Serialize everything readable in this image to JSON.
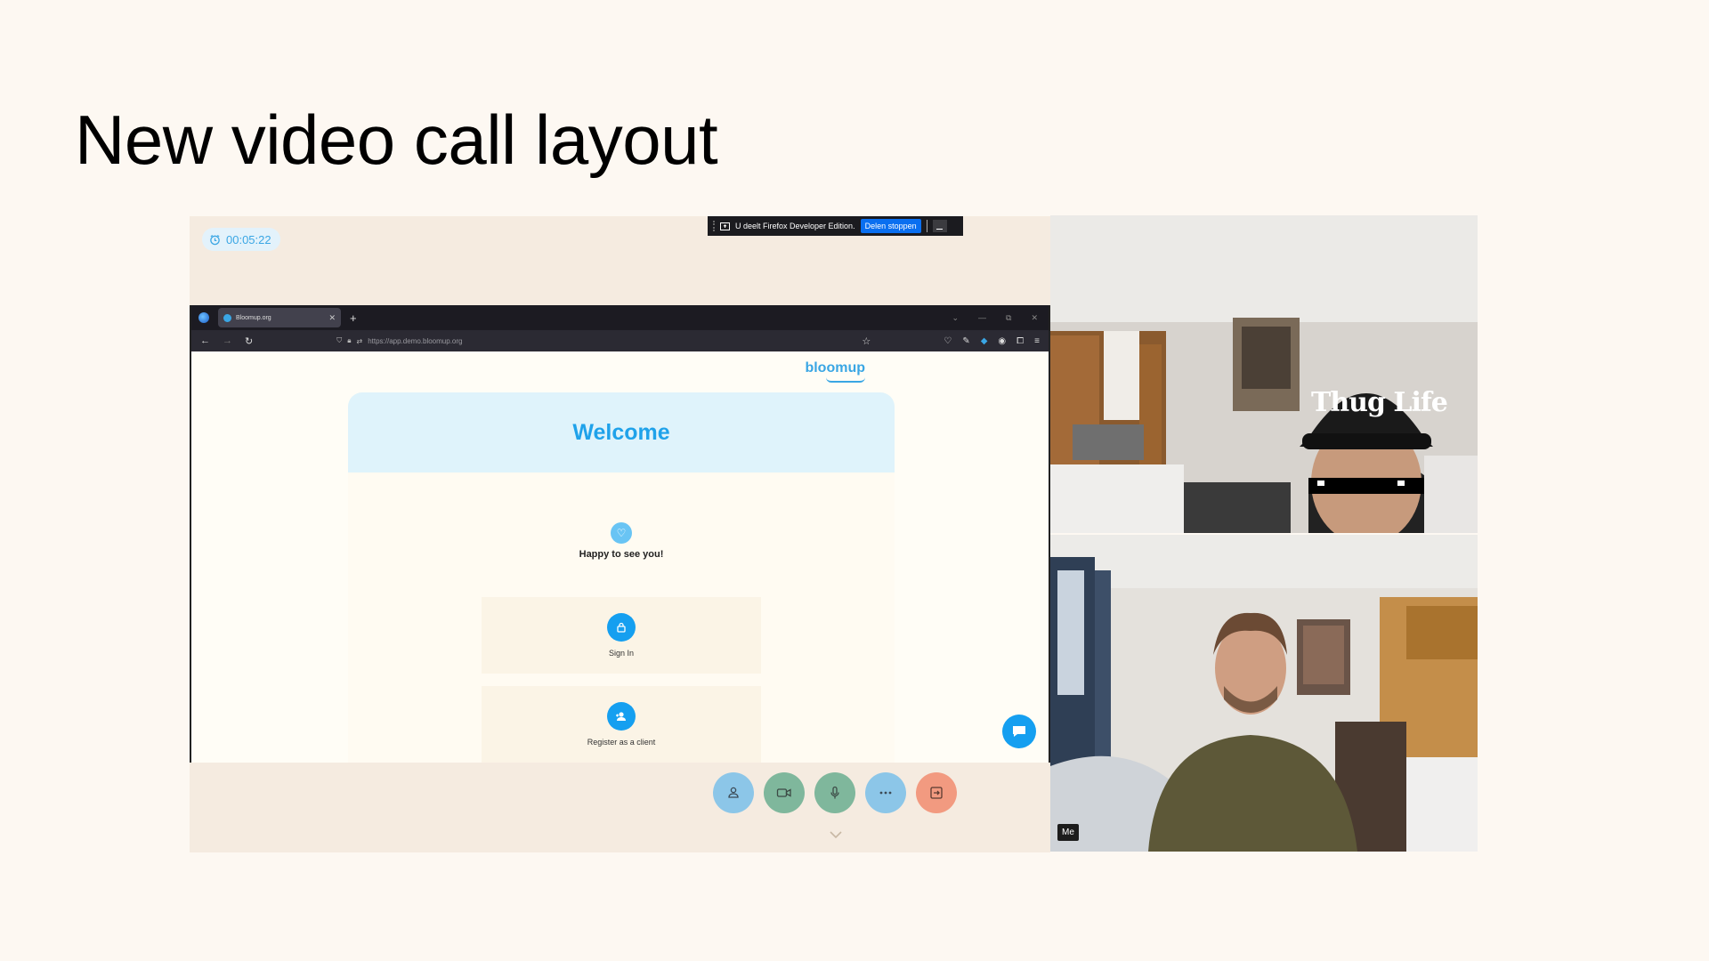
{
  "slide": {
    "title": "New video call layout"
  },
  "call": {
    "timer": "00:05:22",
    "share_bar": {
      "text": "U deelt Firefox Developer Edition.",
      "stop_label": "Delen stoppen"
    },
    "browser": {
      "tab_title": "Bloomup.org",
      "url": "https://app.demo.bloomup.org"
    },
    "page": {
      "brand": "bloomup",
      "welcome": "Welcome",
      "greeting": "Happy to see you!",
      "sign_in": "Sign In",
      "register": "Register as a client"
    },
    "controls": [
      {
        "name": "participants-button",
        "icon": "person-icon",
        "color": "#8cc6e8"
      },
      {
        "name": "camera-button",
        "icon": "video-camera-icon",
        "color": "#7fb79c"
      },
      {
        "name": "microphone-button",
        "icon": "microphone-icon",
        "color": "#7fb79c"
      },
      {
        "name": "more-button",
        "icon": "more-dots-icon",
        "color": "#8cc6e8"
      },
      {
        "name": "leave-button",
        "icon": "exit-icon",
        "color": "#f29a80"
      }
    ]
  },
  "videos": {
    "remote": {
      "overlay_text": "Thug Life"
    },
    "self": {
      "badge": "Me"
    }
  }
}
